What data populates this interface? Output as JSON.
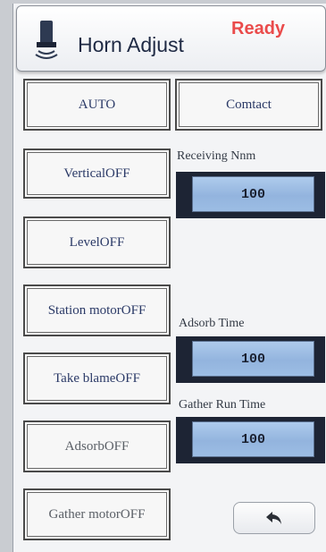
{
  "header": {
    "title": "Horn Adjust",
    "status": "Ready",
    "status_color": "#ea4b4b",
    "icon": "horn-icon"
  },
  "buttons": {
    "auto": "AUTO",
    "contact": "Comtact",
    "vertical": "VerticalOFF",
    "level": "LevelOFF",
    "station_motor": "Station motorOFF",
    "take_blame": "Take blameOFF",
    "adsorb": "AdsorbOFF",
    "gather_motor": "Gather motorOFF",
    "back_icon": "back-arrow-icon"
  },
  "fields": {
    "receiving_num": {
      "label": "Receiving Nnm",
      "value": "100"
    },
    "adsorb_time": {
      "label": "Adsorb Time",
      "value": "100"
    },
    "gather_run_time": {
      "label": "Gather Run Time",
      "value": "100"
    }
  },
  "colors": {
    "field_fill": "#9cbde4",
    "panel_dark": "#1d2434",
    "button_text": "#2b3a67"
  }
}
